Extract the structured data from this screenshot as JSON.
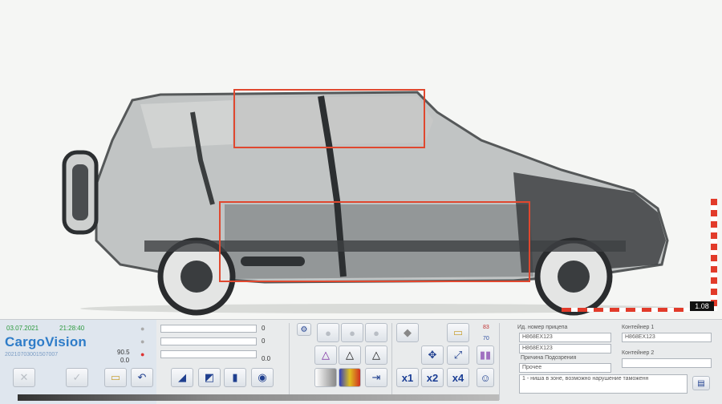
{
  "scan": {
    "zoom_readout": "1.08"
  },
  "info": {
    "date": "03.07.2021",
    "time": "21:28:40",
    "brand": "CargoVision",
    "serial": "20210703001507007",
    "value_a": "90.5",
    "value_b": "0.0",
    "slider_1": "0",
    "slider_2": "0",
    "slider_3": "0.0"
  },
  "toolbar": {
    "zoom_x1": "x1",
    "zoom_x2": "x2",
    "zoom_x4": "x4",
    "indicator_1": "83",
    "indicator_2": "70"
  },
  "vehicle": {
    "trailer_label": "Ид. номер прицепа",
    "container1_label": "Контейнер 1",
    "trailer_value": "H868EX123",
    "trailer_value_2": "H868EX123",
    "container1_value": "H868EX123",
    "reason_label": "Причина Подозрения",
    "reason_value": "Прочее",
    "container2_label": "Контейнер 2",
    "comment": "1 - ниша в зоне, возможно нарушение таможенн"
  }
}
